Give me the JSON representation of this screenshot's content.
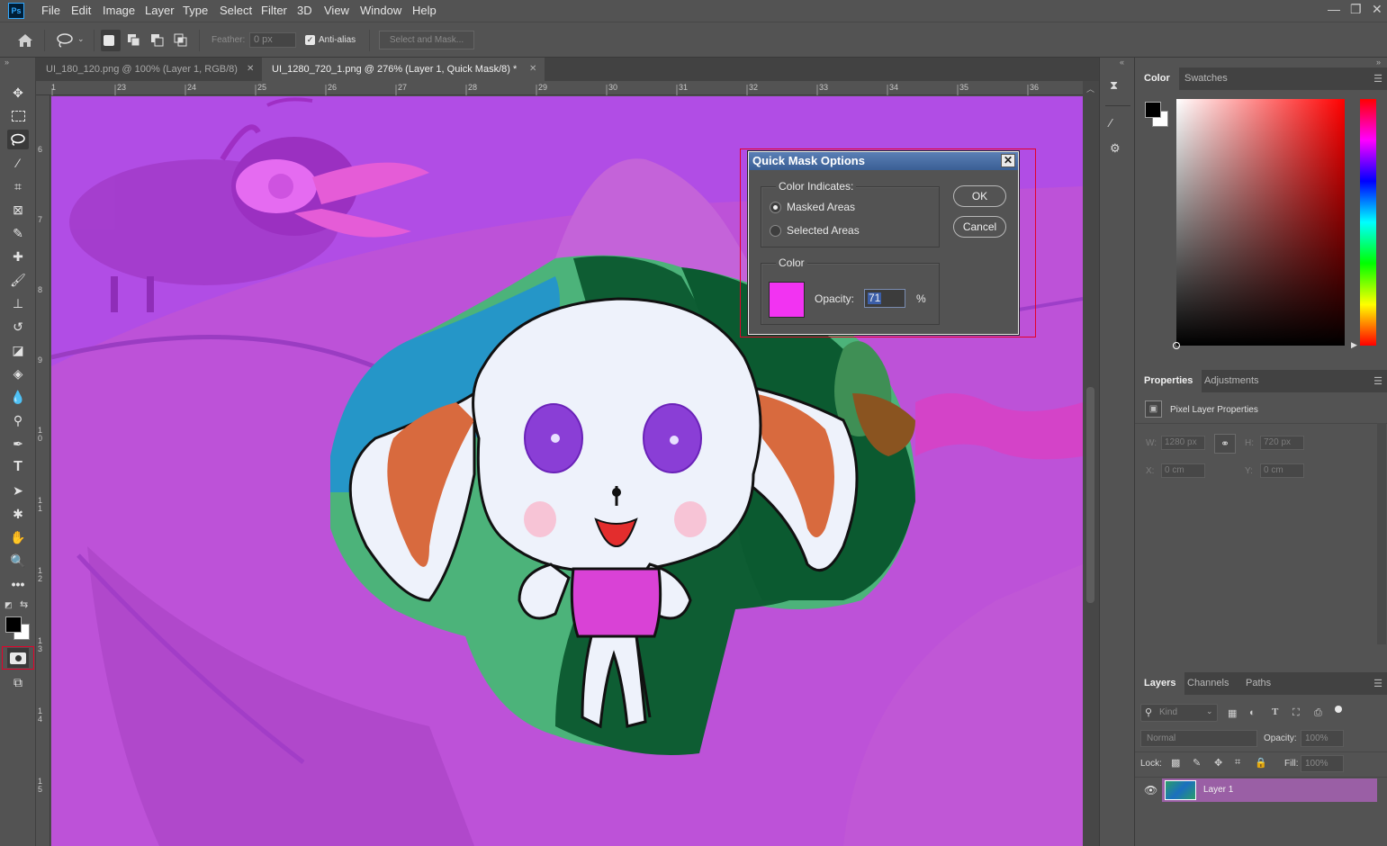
{
  "app": {
    "logo": "Ps"
  },
  "menu": [
    "File",
    "Edit",
    "Image",
    "Layer",
    "Type",
    "Select",
    "Filter",
    "3D",
    "View",
    "Window",
    "Help"
  ],
  "options": {
    "feather_label": "Feather:",
    "feather_value": "0 px",
    "antialias_label": "Anti-alias",
    "antialias_checked": true,
    "select_mask_label": "Select and Mask..."
  },
  "tabs": [
    {
      "label": "UI_180_120.png @ 100% (Layer 1, RGB/8)",
      "active": false
    },
    {
      "label": "UI_1280_720_1.png @ 276% (Layer 1, Quick Mask/8) *",
      "active": true
    }
  ],
  "ruler": {
    "h_ticks": [
      "1",
      "23",
      "24",
      "25",
      "26",
      "27",
      "28",
      "29",
      "30",
      "31",
      "32",
      "33",
      "34",
      "35",
      "36"
    ],
    "v_ticks": [
      "6",
      "7",
      "8",
      "9",
      "1\n0",
      "1\n1",
      "1\n2",
      "1\n3",
      "1\n4",
      "1\n5"
    ]
  },
  "dialog": {
    "title": "Quick Mask Options",
    "close": "✕",
    "color_indicates_label": "Color Indicates:",
    "option_masked": "Masked Areas",
    "option_selected": "Selected Areas",
    "selected_option": "masked",
    "color_group_label": "Color",
    "mask_color": "#f233f2",
    "opacity_label": "Opacity:",
    "opacity_value": "71",
    "opacity_unit": "%",
    "ok_label": "OK",
    "cancel_label": "Cancel"
  },
  "color_panel": {
    "tabs": [
      "Color",
      "Swatches"
    ],
    "active_tab": "Color",
    "foreground": "#000000",
    "background": "#ffffff"
  },
  "properties_panel": {
    "tabs": [
      "Properties",
      "Adjustments"
    ],
    "active_tab": "Properties",
    "heading": "Pixel Layer Properties",
    "w_label": "W:",
    "w_value": "1280 px",
    "h_label": "H:",
    "h_value": "720 px",
    "x_label": "X:",
    "x_value": "0 cm",
    "y_label": "Y:",
    "y_value": "0 cm"
  },
  "layers_panel": {
    "tabs": [
      "Layers",
      "Channels",
      "Paths"
    ],
    "active_tab": "Layers",
    "filter_placeholder": "Kind",
    "blend_mode": "Normal",
    "opacity_label": "Opacity:",
    "opacity_value": "100%",
    "lock_label": "Lock:",
    "fill_label": "Fill:",
    "fill_value": "100%",
    "layers": [
      {
        "name": "Layer 1",
        "visible": true,
        "selected": true
      }
    ]
  },
  "accent": {
    "highlight_red": "#e5002a",
    "layer_selected": "#9a5fa5"
  }
}
